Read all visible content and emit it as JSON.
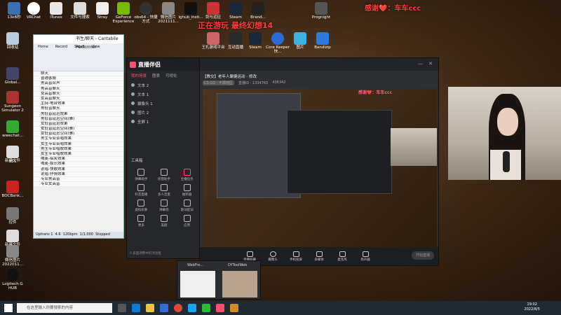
{
  "desktop": {
    "top_icons": [
      {
        "label": "13kB秒",
        "icon": "monitor-icon"
      },
      {
        "label": "VRChat",
        "icon": "vrchat-icon"
      },
      {
        "label": "iTunes",
        "icon": "itunes-icon"
      },
      {
        "label": "文件与搜索",
        "icon": "folder-icon"
      },
      {
        "label": "Stray",
        "icon": "cat-icon"
      },
      {
        "label": "GeForce Experience",
        "icon": "nvidia-icon"
      },
      {
        "label": "obs64 - 快捷方式",
        "icon": "obs-icon"
      },
      {
        "label": "微信图片 2021111...",
        "icon": "image-icon"
      },
      {
        "label": "lghub_insti...",
        "icon": "logitech-icon"
      },
      {
        "label": "剑与远征",
        "icon": "game-icon"
      },
      {
        "label": "Steam",
        "icon": "steam-icon"
      },
      {
        "label": "Brand...",
        "icon": "brand-icon"
      },
      {
        "label": "Prognight",
        "icon": "prognight-icon"
      }
    ],
    "second_row": [
      {
        "label": "回收站",
        "icon": "recycle-bin-icon"
      },
      {
        "label": "互动直播",
        "icon": "live-icon"
      },
      {
        "label": "Steam",
        "icon": "steam-icon"
      },
      {
        "label": "Core Keeper 快...",
        "icon": "corekeeper-icon"
      },
      {
        "label": "图片",
        "icon": "picture-icon"
      },
      {
        "label": "Bandizip",
        "icon": "bandizip-icon"
      },
      {
        "label": "王扎游戏平台",
        "icon": "game-platform-icon"
      }
    ],
    "left_icons": [
      {
        "label": "Global...",
        "icon": "globe-icon"
      },
      {
        "label": "Sungeon Simulator 2",
        "icon": "game-icon"
      },
      {
        "label": "wwechat...",
        "icon": "wechat-icon"
      },
      {
        "label": "新建文件",
        "icon": "file-icon"
      },
      {
        "label": "551",
        "icon": "file-icon"
      },
      {
        "label": "BOCBank...",
        "icon": "bank-icon"
      },
      {
        "label": "控件",
        "icon": "control-icon"
      },
      {
        "label": "新建文件",
        "icon": "file-icon"
      },
      {
        "label": "微信图片 2022011...",
        "icon": "image-icon"
      },
      {
        "label": "Logitech G HUB",
        "icon": "logitech-icon"
      }
    ]
  },
  "banner": {
    "thanks": "感谢❤️：车车ccc",
    "playing": "正在游玩 最终幻想14"
  },
  "cantabile": {
    "title": "书生/聊天 - Cantabile Performer",
    "tabs": [
      "Home",
      "Record",
      "Setup",
      "View"
    ],
    "version": "Cantabile 3.0.0.2066",
    "rows": [
      "聊天",
      "普通客服",
      "男高音合声",
      "男高音聊天",
      "女高音聊天",
      "女高音聊天",
      "主持-电台效果",
      "男低音聊天",
      "男低音延迟效果",
      "男低音延迟空间(雅)",
      "女低音延迟效果",
      "女低音延迟空间(雅)",
      "女低音延迟空间(雅)",
      "男生专业合唱效果",
      "女生专业合唱效果",
      "男生专业唱歌效果",
      "女生专业唱歌效果",
      "喊麦-搞笑效果",
      "喊麦-娱乐效果",
      "说唱-快歌效果",
      "说唱-抒情效果",
      "专业男高音",
      "专业女高音"
    ],
    "status": [
      "Uptrans 1",
      "4.6",
      "120bpm",
      "1/1,000",
      "Stopped"
    ]
  },
  "live": {
    "logo": "直播伴侣",
    "tabs": [
      "我的场景",
      "图表",
      "可视化"
    ],
    "sources": [
      "文本 2",
      "文本 1",
      "摄像头 1",
      "图片 2",
      "全屏 1"
    ],
    "tools_title": "工具箱",
    "tools": [
      "弹幕助手",
      "房管助手",
      "主播任务",
      "抖音直播",
      "多人连麦",
      "抽奖器",
      "虚拟形象",
      "弹幕卷",
      "歌词提词",
      "更多",
      "美颜",
      "应用"
    ],
    "footer": "0 表面调整中的消息框"
  },
  "room": {
    "title": "【教交】老年人聚健运动 - 修改",
    "tags": [
      "CS:GO · 不限地区",
      "直播ID · 1334765",
      "436342"
    ],
    "controls": [
      "直播屏幕",
      "摄像头",
      "手机投屏",
      "多媒体",
      "麦克风",
      "扬声器"
    ],
    "start_label": "开始直播"
  },
  "overlay_thanks": "感谢❤️：车车ccc",
  "taskbar": {
    "search_placeholder": "在这里输入你要搜索的内容",
    "apps": [
      {
        "icon": "windows-icon"
      },
      {
        "icon": "task-view-icon"
      },
      {
        "icon": "edge-icon"
      },
      {
        "icon": "explorer-icon"
      },
      {
        "icon": "store-icon"
      },
      {
        "icon": "chrome-icon"
      },
      {
        "icon": "qq-icon"
      },
      {
        "icon": "wechat-icon"
      },
      {
        "icon": "live-app-icon"
      },
      {
        "icon": "cantabile-icon"
      }
    ],
    "time": "19:02",
    "date": "2022/8/5"
  },
  "thumb_windows": [
    "WebFre...",
    "DYToolWeb"
  ]
}
